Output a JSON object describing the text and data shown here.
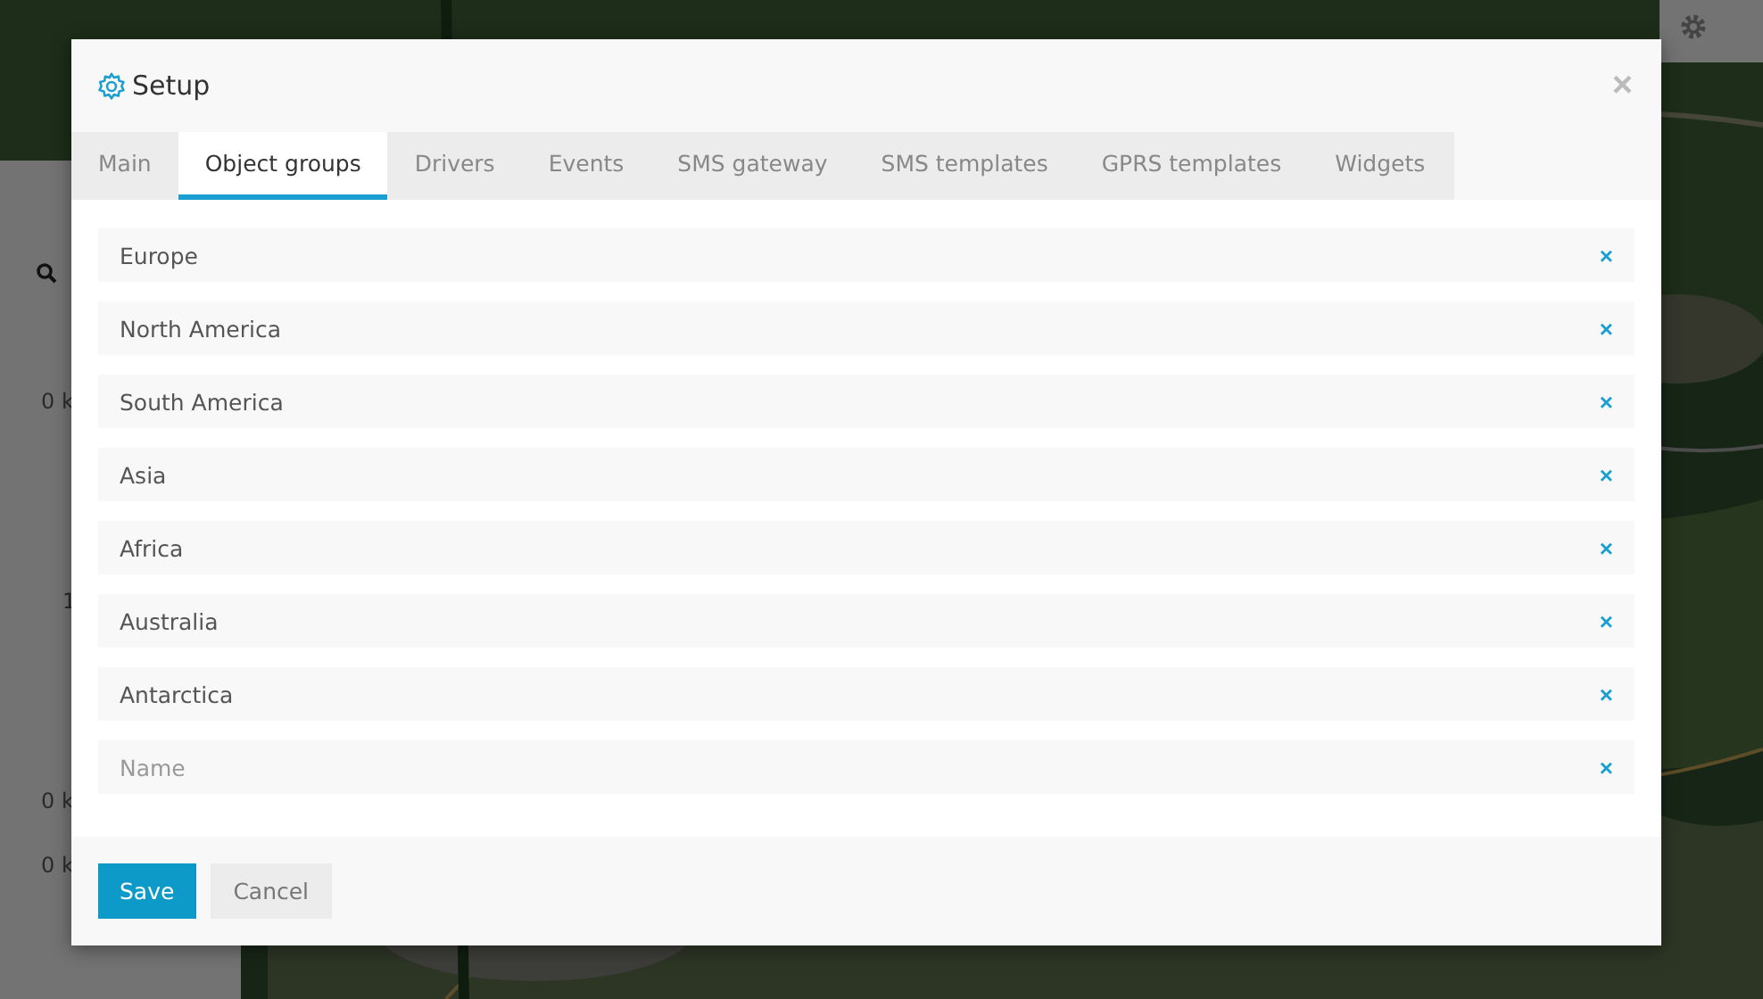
{
  "background": {
    "side_panel": {
      "readings": [
        "0 k",
        "1",
        "0 k",
        "0 k"
      ]
    }
  },
  "dialog": {
    "title": "Setup",
    "close": "×",
    "tabs": [
      {
        "label": "Main",
        "selected": false
      },
      {
        "label": "Object groups",
        "selected": true
      },
      {
        "label": "Drivers",
        "selected": false
      },
      {
        "label": "Events",
        "selected": false
      },
      {
        "label": "SMS gateway",
        "selected": false
      },
      {
        "label": "SMS templates",
        "selected": false
      },
      {
        "label": "GPRS templates",
        "selected": false
      },
      {
        "label": "Widgets",
        "selected": false
      }
    ],
    "groups": [
      {
        "value": "Europe",
        "remove": "×"
      },
      {
        "value": "North America",
        "remove": "×"
      },
      {
        "value": "South America",
        "remove": "×"
      },
      {
        "value": "Asia",
        "remove": "×"
      },
      {
        "value": "Africa",
        "remove": "×"
      },
      {
        "value": "Australia",
        "remove": "×"
      },
      {
        "value": "Antarctica",
        "remove": "×"
      },
      {
        "placeholder": "Name",
        "remove": "×"
      }
    ],
    "buttons": [
      {
        "label": "Save",
        "kind": "primary"
      },
      {
        "label": "Cancel",
        "kind": "secondary"
      }
    ]
  }
}
